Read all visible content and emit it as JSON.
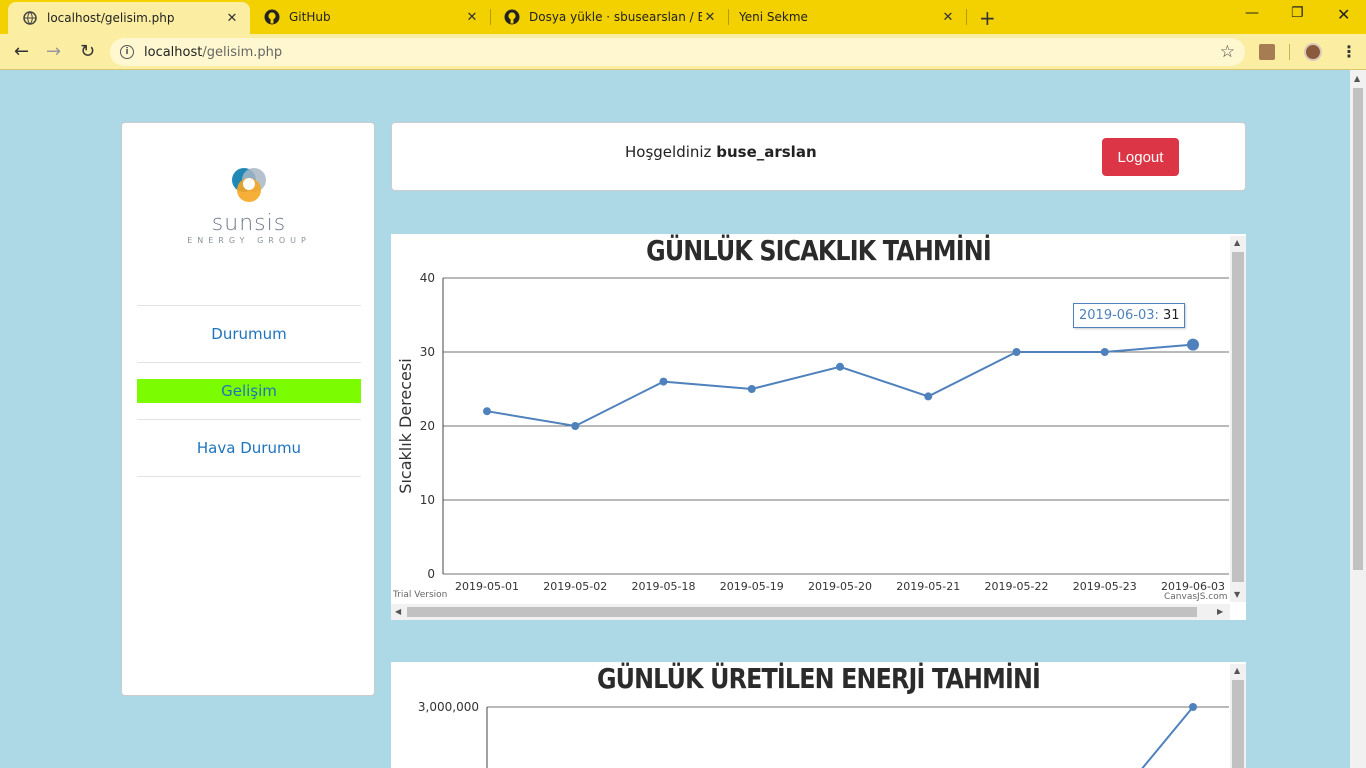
{
  "browser": {
    "tabs": [
      {
        "title": "localhost/gelisim.php",
        "active": true
      },
      {
        "title": "GitHub",
        "active": false
      },
      {
        "title": "Dosya yükle · sbusearslan / Enerji",
        "active": false
      },
      {
        "title": "Yeni Sekme",
        "active": false
      }
    ],
    "url_host": "localhost",
    "url_path": "/gelisim.php"
  },
  "sidebar": {
    "brand": "sunsis",
    "brand_sub": "ENERGY GROUP",
    "items": [
      {
        "label": "Durumum",
        "active": false
      },
      {
        "label": "Gelişim",
        "active": true
      },
      {
        "label": "Hava Durumu",
        "active": false
      }
    ]
  },
  "header": {
    "welcome": "Hoşgeldiniz",
    "username": "buse_arslan",
    "logout_label": "Logout"
  },
  "colors": {
    "accent_active": "#7cfc00",
    "logout": "#dc3545",
    "series": "#4f81bc",
    "link": "#1e73be"
  },
  "chart_data": [
    {
      "type": "line",
      "title": "GÜNLÜK SICAKLIK TAHMİNİ",
      "ylabel": "Sıcaklık Derecesi",
      "xlabel": "",
      "categories": [
        "2019-05-01",
        "2019-05-02",
        "2019-05-18",
        "2019-05-19",
        "2019-05-20",
        "2019-05-21",
        "2019-05-22",
        "2019-05-23",
        "2019-06-03"
      ],
      "values": [
        22,
        20,
        26,
        25,
        28,
        24,
        30,
        30,
        31
      ],
      "ylim": [
        0,
        40
      ],
      "yticks": [
        0,
        10,
        20,
        30,
        40
      ],
      "grid": true,
      "tooltip": {
        "label": "2019-06-03:",
        "value": "31"
      },
      "watermark_left": "Trial Version",
      "watermark_right": "CanvasJS.com"
    },
    {
      "type": "line",
      "title": "GÜNLÜK ÜRETİLEN ENERJİ TAHMİNİ",
      "yticks_visible": [
        "3,000,000"
      ],
      "ylim_top": 3000000
    }
  ]
}
